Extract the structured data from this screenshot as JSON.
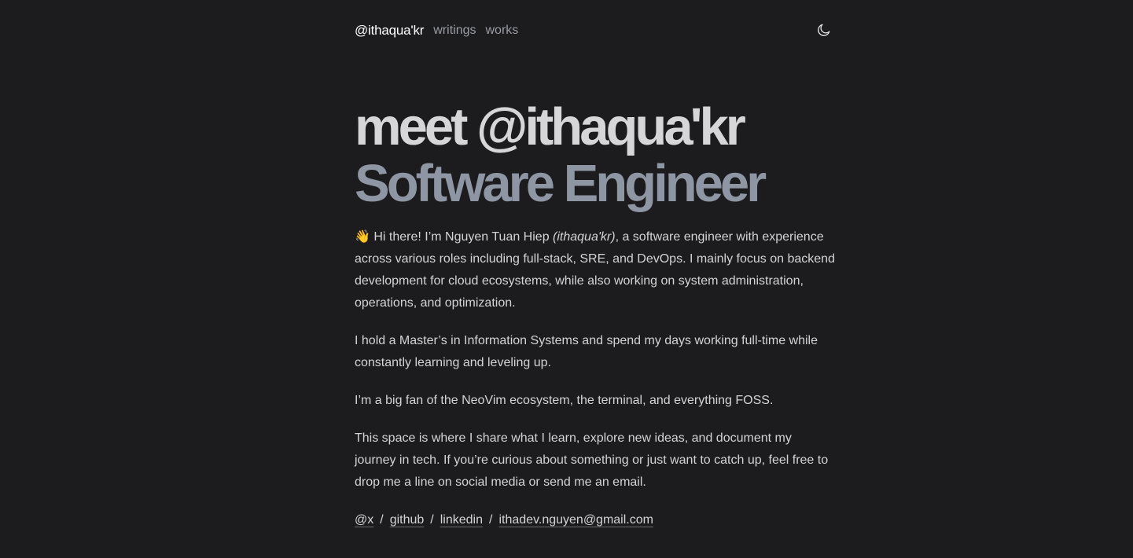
{
  "nav": {
    "brand": "@ithaqua'kr",
    "links": [
      "writings",
      "works"
    ],
    "theme_icon": "moon-icon"
  },
  "hero": {
    "line1": "meet @ithaqua'kr",
    "line2": "Software Engineer"
  },
  "intro": {
    "emoji": "👋",
    "before": " Hi there! I’m Nguyen Tuan Hiep ",
    "alias": "(ithaqua'kr)",
    "after": ", a software engineer with experience across various roles including full-stack, SRE, and DevOps. I mainly focus on backend development for cloud ecosystems, while also working on system administration, operations, and optimization."
  },
  "paragraphs": [
    "I hold a Master’s in Information Systems and spend my days working full-time while constantly learning and leveling up.",
    "I’m a big fan of the NeoVim ecosystem, the terminal, and everything FOSS.",
    "This space is where I share what I learn, explore new ideas, and document my journey in tech. If you’re curious about something or just want to catch up, feel free to drop me a line on social media or send me an email."
  ],
  "socials": {
    "x": "@x",
    "github": "github",
    "linkedin": "linkedin",
    "email": "ithadev.nguyen@gmail.com",
    "separator": "/"
  },
  "colors": {
    "background": "#1c1c1e",
    "text": "#d4d4d8",
    "accent_muted": "#8f96a3"
  }
}
